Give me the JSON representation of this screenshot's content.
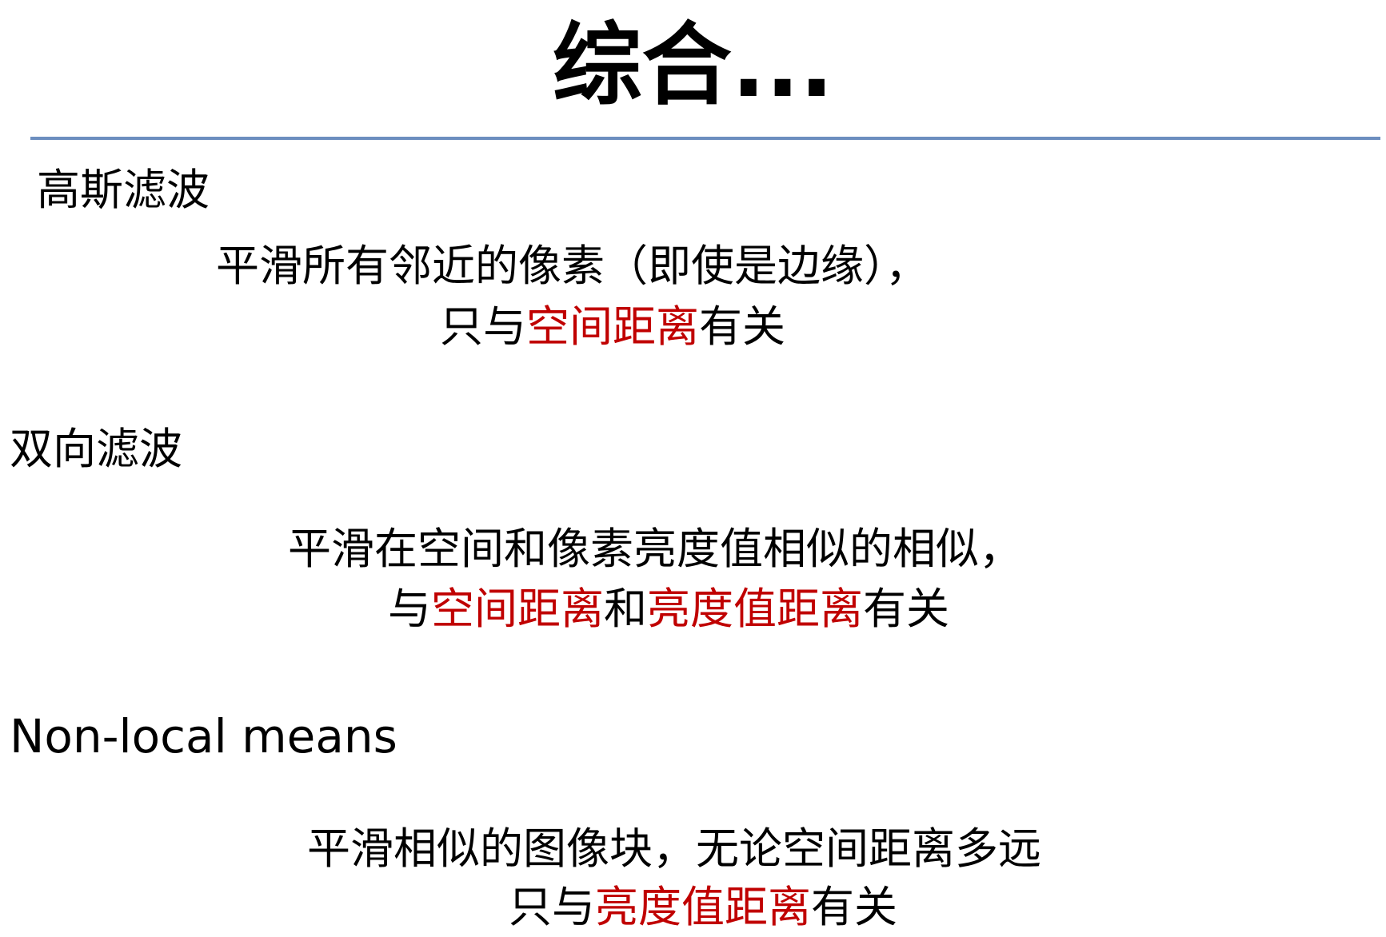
{
  "title": "综合...",
  "colors": {
    "rule": "#6c8ebf",
    "highlight": "#c00000",
    "text": "#000000"
  },
  "sections": [
    {
      "heading": "高斯滤波",
      "line1": "平滑所有邻近的像素（即使是边缘），",
      "line2": {
        "pre": "只与",
        "hl1": "空间距离",
        "post": "有关"
      }
    },
    {
      "heading": "双向滤波",
      "line1": "平滑在空间和像素亮度值相似的相似，",
      "line2": {
        "pre": "与",
        "hl1": "空间距离",
        "mid": "和",
        "hl2": "亮度值距离",
        "post": "有关"
      }
    },
    {
      "heading": "Non-local means",
      "line1": "平滑相似的图像块，无论空间距离多远",
      "line2": {
        "pre": "只与",
        "hl1": "亮度值距离",
        "post": "有关"
      }
    }
  ]
}
